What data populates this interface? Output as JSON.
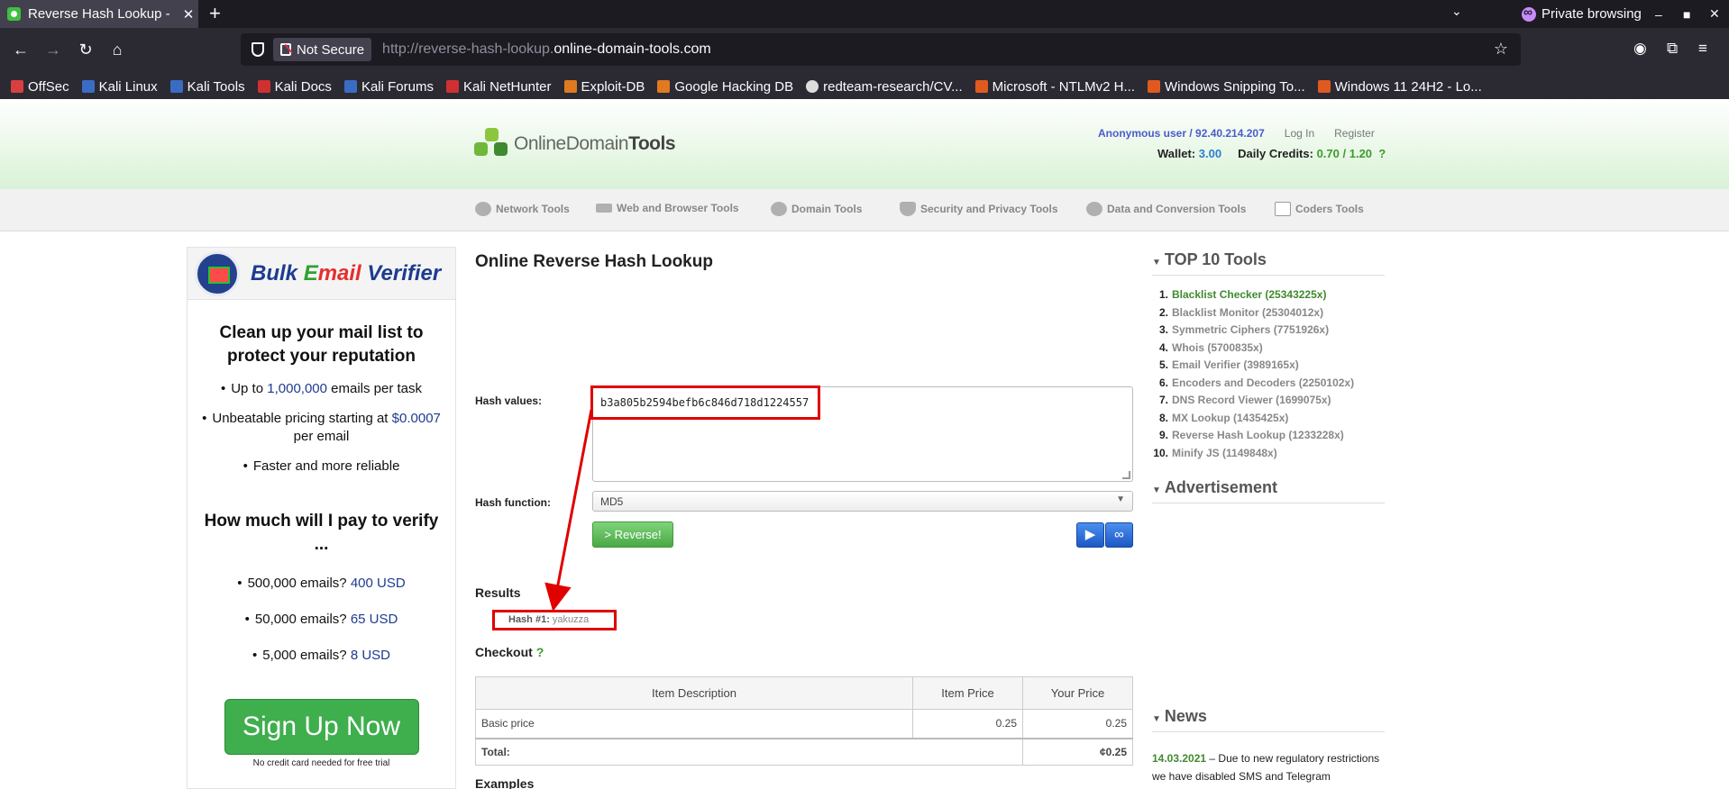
{
  "browser": {
    "tab_title": "Reverse Hash Lookup - Re",
    "tab_close": "✕",
    "new_tab": "+",
    "private_label": "Private browsing",
    "not_secure": "Not Secure",
    "url_prefix": "http://reverse-hash-lookup.",
    "url_host": "online-domain-tools.com",
    "bookmarks": [
      "OffSec",
      "Kali Linux",
      "Kali Tools",
      "Kali Docs",
      "Kali Forums",
      "Kali NetHunter",
      "Exploit-DB",
      "Google Hacking DB",
      "redteam-research/CV...",
      "Microsoft - NTLMv2 H...",
      "Windows Snipping To...",
      "Windows 11 24H2 - Lo..."
    ]
  },
  "header": {
    "logo_light": "Online",
    "logo_mid": "Domain",
    "logo_bold": "Tools",
    "user": "Anonymous user / 92.40.214.207",
    "login": "Log In",
    "register": "Register",
    "wallet_label": "Wallet:",
    "wallet_value": "3.00",
    "credits_label": "Daily Credits:",
    "credits_used": "0.70",
    "credits_sep": " / ",
    "credits_total": "1.20",
    "help": "?"
  },
  "menu": [
    "Network Tools",
    "Web and Browser Tools",
    "Domain Tools",
    "Security and Privacy Tools",
    "Data and Conversion Tools",
    "Coders Tools"
  ],
  "ad": {
    "brand_a": "Bulk ",
    "brand_b": "E",
    "brand_c": "mail",
    "brand_d": " Verifier",
    "heading": "Clean up your mail list to protect your reputation",
    "bullets": [
      {
        "pre": "Up to ",
        "num": "1,000,000",
        "post": " emails per task"
      },
      {
        "pre": "Unbeatable pricing starting at ",
        "num": "$0.0007",
        "post": " per email"
      },
      {
        "pre": "Faster and more reliable",
        "num": "",
        "post": ""
      }
    ],
    "heading2": "How much will I pay to verify ...",
    "prices": [
      {
        "pre": "500,000 emails? ",
        "num": "400 USD"
      },
      {
        "pre": "50,000 emails? ",
        "num": "65 USD"
      },
      {
        "pre": "5,000 emails? ",
        "num": "8 USD"
      }
    ],
    "signup": "Sign Up Now",
    "note": "No credit card needed for free trial"
  },
  "main": {
    "title": "Online Reverse Hash Lookup",
    "hash_label": "Hash values:",
    "hash_value": "b3a805b2594befb6c846d718d1224557",
    "function_label": "Hash function:",
    "function_value": "MD5",
    "reverse_button": "> Reverse!",
    "results_label": "Results",
    "result_key": "Hash #1:",
    "result_value": " yakuzza",
    "checkout_label": "Checkout",
    "checkout_help": "?",
    "table": {
      "headers": [
        "Item Description",
        "Item Price",
        "Your Price"
      ],
      "rows": [
        [
          "Basic price",
          "0.25",
          "0.25"
        ]
      ],
      "total_label": "Total:",
      "total_value": "¢0.25"
    },
    "examples_label": "Examples"
  },
  "sidebar": {
    "top10_title": "TOP 10 Tools",
    "top10": [
      "Blacklist Checker (25343225x)",
      "Blacklist Monitor (25304012x)",
      "Symmetric Ciphers (7751926x)",
      "Whois (5700835x)",
      "Email Verifier (3989165x)",
      "Encoders and Decoders (2250102x)",
      "DNS Record Viewer (1699075x)",
      "MX Lookup (1435425x)",
      "Reverse Hash Lookup (1233228x)",
      "Minify JS (1149848x)"
    ],
    "ad_title": "Advertisement",
    "news_title": "News",
    "news_date": "14.03.2021",
    "news_text": " – Due to new regulatory restrictions we have disabled SMS and Telegram notifications. Other types of"
  }
}
